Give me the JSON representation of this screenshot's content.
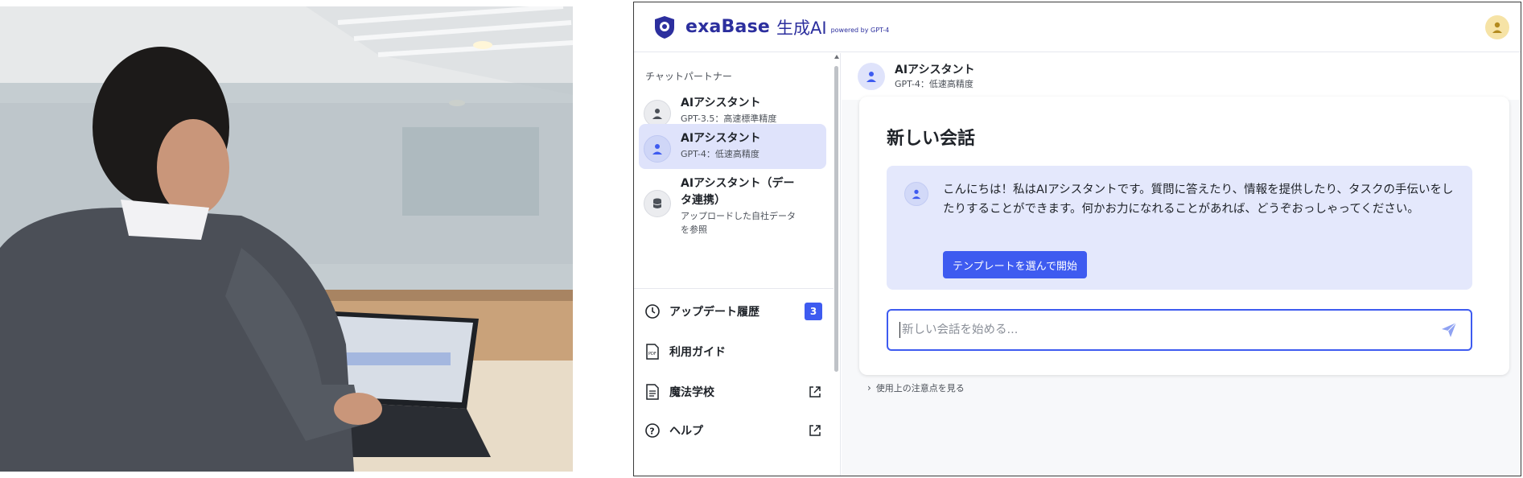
{
  "app": {
    "brand": "exaBase",
    "brand_sub": "生成AI",
    "powered_by": "powered by GPT-4"
  },
  "sidebar": {
    "heading": "チャットパートナー",
    "partners": [
      {
        "name": "AIアシスタント",
        "desc": "GPT-3.5：高速標準精度"
      },
      {
        "name": "AIアシスタント",
        "desc": "GPT-4：低速高精度",
        "active": true
      },
      {
        "name": "AIアシスタント（データ連携）",
        "desc": "アップロードした自社データを参照"
      }
    ],
    "menu": [
      {
        "label": "アップデート履歴",
        "badge": "3",
        "icon": "clock-icon"
      },
      {
        "label": "利用ガイド",
        "icon": "pdf-file-icon"
      },
      {
        "label": "魔法学校",
        "icon": "document-icon",
        "external": true
      },
      {
        "label": "ヘルプ",
        "icon": "help-circle-icon",
        "external": true
      }
    ]
  },
  "chat": {
    "header_name": "AIアシスタント",
    "header_desc": "GPT-4：低速高精度",
    "title": "新しい会話",
    "welcome_text": "こんにちは！私はAIアシスタントです。質問に答えたり、情報を提供したり、タスクの手伝いをしたりすることができます。何かお力になれることがあれば、どうぞおっしゃってください。",
    "template_button": "テンプレートを選んで開始",
    "input_placeholder": "新しい会話を始める...",
    "notes_link": "使用上の注意点を見る"
  },
  "colors": {
    "accent": "#3e5bf0",
    "brand": "#2c2f9e",
    "active_bg": "#dfe3fb"
  }
}
